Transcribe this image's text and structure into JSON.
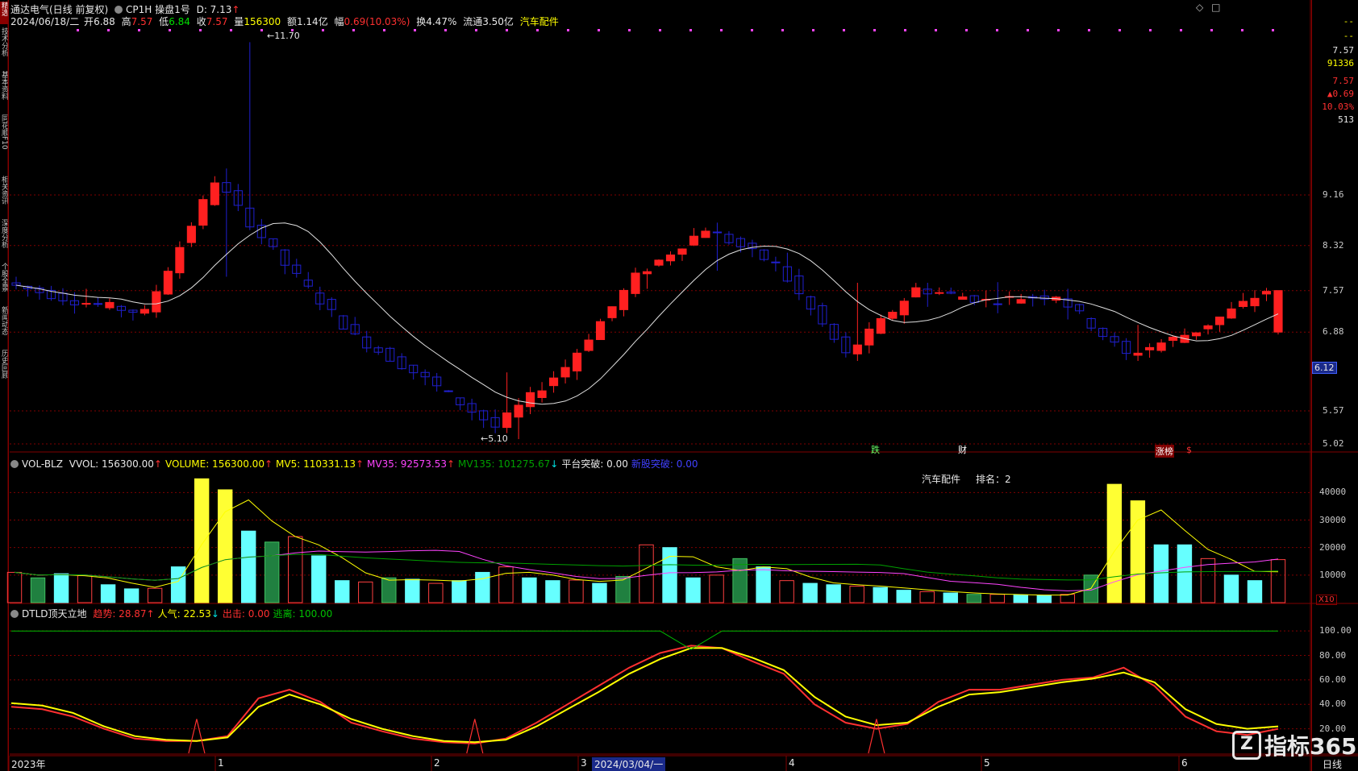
{
  "window": {
    "stock_name": "通达电气(日线 前复权)",
    "formula_name": "CP1H 操盘1号",
    "formula_value": "D: 7.13",
    "formula_arrow": "↑",
    "top_right_icons": [
      "◇",
      "□"
    ]
  },
  "quote": {
    "date": "2024/06/18/二",
    "open_label": "开",
    "open": "6.88",
    "high_label": "高",
    "high": "7.57",
    "low_label": "低",
    "low": "6.84",
    "close_label": "收",
    "close": "7.57",
    "volume_label": "量",
    "volume": "156300",
    "amount_label": "额",
    "amount": "1.14亿",
    "change_label": "幅",
    "change": "0.69(10.03%)",
    "turnover_label": "换",
    "turnover": "4.47%",
    "float_label": "流通",
    "float": "3.50亿",
    "sector": "汽车配件"
  },
  "left_tabs": [
    "精选",
    "技术分析",
    "基本资料",
    "同花顺F10",
    "相关资讯",
    "深度分析",
    "个股全景",
    "新闻动态",
    "历史回顾"
  ],
  "right_panel": {
    "dash1": "--",
    "dash2": "--",
    "price": "7.57",
    "volume": "91336",
    "price2": "7.57",
    "change": "▲0.69",
    "change_pct": "10.03%",
    "count": "513"
  },
  "price_axis": {
    "ticks": [
      "9.16",
      "8.32",
      "7.57",
      "6.88",
      "5.57",
      "5.02"
    ],
    "current_label": "6.12"
  },
  "price_annotations": {
    "high_label": "11.70",
    "low_label": "5.10",
    "markers": [
      {
        "text": "跌",
        "color": "#66ff66"
      },
      {
        "text": "财",
        "color": "#ffffff"
      },
      {
        "text": "涨",
        "color": "#ffffff"
      },
      {
        "text": "榜",
        "color": "#ffffff"
      },
      {
        "text": "$",
        "color": "#ff3333"
      }
    ]
  },
  "volume_panel": {
    "header": {
      "name": "VOL-BLZ",
      "items": [
        {
          "label": "VVOL: 156300.00",
          "arrow": "↑",
          "color": "#e8e8e8"
        },
        {
          "label": "VOLUME: 156300.00",
          "arrow": "↑",
          "color": "#ffff00"
        },
        {
          "label": "MV5: 110331.13",
          "arrow": "↑",
          "color": "#ffff00"
        },
        {
          "label": "MV35: 92573.53",
          "arrow": "↑",
          "color": "#ff44ff"
        },
        {
          "label": "MV135: 101275.67",
          "arrow": "↓",
          "color": "#00a000"
        },
        {
          "label": "平台突破: 0.00",
          "arrow": "",
          "color": "#e8e8e8"
        },
        {
          "label": "新股突破: 0.00",
          "arrow": "",
          "color": "#4040ff"
        }
      ]
    },
    "sector_rank_label": "汽车配件",
    "rank_text": "排名：2",
    "ticks": [
      "40000",
      "30000",
      "20000",
      "10000"
    ],
    "unit": "X10"
  },
  "indicator_panel": {
    "header": {
      "name": "DTLD顶天立地",
      "items": [
        {
          "label": "趋势: 28.87",
          "arrow": "↑",
          "color": "#ff3030"
        },
        {
          "label": "人气: 22.53",
          "arrow": "↓",
          "color": "#ffff00"
        },
        {
          "label": "出击: 0.00",
          "arrow": "",
          "color": "#ff3030"
        },
        {
          "label": "逃离: 100.00",
          "arrow": "",
          "color": "#00c000"
        }
      ]
    },
    "ticks": [
      "100.00",
      "80.00",
      "60.00",
      "40.00",
      "20.00"
    ]
  },
  "time_axis": {
    "labels": [
      "2023年",
      "1",
      "2",
      "3",
      "2024/03/04/一",
      "4",
      "5",
      "6"
    ],
    "period": "日线"
  },
  "watermark": "指标365",
  "colors": {
    "up": "#ff2020",
    "down": "#2020d0",
    "grid": "#800000",
    "ma": "#e0e0e0"
  },
  "chart_data": [
    {
      "type": "candlestick",
      "title": "通达电气(日线 前复权)",
      "x": [
        "2023-12",
        "2024-01",
        "2024-02",
        "2024-03",
        "2024-04",
        "2024-05",
        "2024-06"
      ],
      "ylim": [
        5.02,
        9.16
      ],
      "ohlc_sample": [
        {
          "o": 7.9,
          "h": 8.1,
          "l": 7.6,
          "c": 7.7
        },
        {
          "o": 7.7,
          "h": 7.8,
          "l": 7.3,
          "c": 7.4
        },
        {
          "o": 7.4,
          "h": 7.6,
          "l": 7.1,
          "c": 7.2
        },
        {
          "o": 7.3,
          "h": 11.7,
          "l": 7.2,
          "c": 9.4
        },
        {
          "o": 9.4,
          "h": 9.6,
          "l": 7.8,
          "c": 8.0
        },
        {
          "o": 8.0,
          "h": 8.1,
          "l": 6.6,
          "c": 6.8
        },
        {
          "o": 6.8,
          "h": 6.9,
          "l": 5.9,
          "c": 6.1
        },
        {
          "o": 6.1,
          "h": 6.2,
          "l": 5.1,
          "c": 5.3
        },
        {
          "o": 5.3,
          "h": 6.4,
          "l": 5.2,
          "c": 6.3
        },
        {
          "o": 6.3,
          "h": 7.9,
          "l": 6.2,
          "c": 7.8
        },
        {
          "o": 7.8,
          "h": 8.9,
          "l": 7.6,
          "c": 8.6
        },
        {
          "o": 8.6,
          "h": 8.7,
          "l": 7.9,
          "c": 8.0
        },
        {
          "o": 8.0,
          "h": 8.2,
          "l": 6.3,
          "c": 6.5
        },
        {
          "o": 6.5,
          "h": 7.7,
          "l": 6.4,
          "c": 7.6
        },
        {
          "o": 7.6,
          "h": 7.7,
          "l": 7.3,
          "c": 7.4
        },
        {
          "o": 7.2,
          "h": 9.2,
          "l": 7.1,
          "c": 7.5
        },
        {
          "o": 7.5,
          "h": 7.6,
          "l": 6.3,
          "c": 6.5
        },
        {
          "o": 6.5,
          "h": 7.0,
          "l": 6.4,
          "c": 6.9
        },
        {
          "o": 6.88,
          "h": 7.57,
          "l": 6.84,
          "c": 7.57
        }
      ],
      "annotations": [
        {
          "label": "11.70",
          "kind": "high"
        },
        {
          "label": "5.10",
          "kind": "low"
        }
      ]
    },
    {
      "type": "bar",
      "title": "VOL-BLZ",
      "ylim": [
        0,
        45000
      ],
      "values": [
        11000,
        9000,
        10500,
        9800,
        6500,
        5000,
        5200,
        13000,
        45000,
        41000,
        26000,
        22000,
        24000,
        17000,
        8000,
        7500,
        9000,
        8500,
        7000,
        8000,
        11000,
        13000,
        9000,
        8000,
        8200,
        7000,
        9500,
        21000,
        20000,
        9000,
        10000,
        16000,
        13000,
        8000,
        7000,
        6500,
        6000,
        5500,
        4500,
        4000,
        3500,
        3000,
        3000,
        2800,
        2500,
        3000,
        10000,
        43000,
        37000,
        21000,
        21000,
        16000,
        10000,
        8000,
        15630
      ],
      "series": [
        {
          "name": "MV5",
          "color": "#ffff00"
        },
        {
          "name": "MV35",
          "color": "#ff44ff"
        },
        {
          "name": "MV135",
          "color": "#00a000"
        }
      ]
    },
    {
      "type": "line",
      "title": "DTLD顶天立地",
      "ylim": [
        0,
        110
      ],
      "series": [
        {
          "name": "趋势",
          "color": "#ff3030",
          "values": [
            38,
            36,
            30,
            20,
            12,
            10,
            10,
            14,
            45,
            52,
            42,
            25,
            18,
            12,
            9,
            8,
            12,
            25,
            40,
            55,
            70,
            82,
            88,
            86,
            75,
            65,
            40,
            25,
            20,
            24,
            42,
            52,
            52,
            56,
            60,
            62,
            70,
            55,
            30,
            18,
            15,
            20
          ]
        },
        {
          "name": "人气",
          "color": "#ffff00",
          "values": [
            41,
            39,
            33,
            22,
            14,
            11,
            10,
            13,
            38,
            48,
            40,
            28,
            20,
            14,
            10,
            9,
            11,
            22,
            36,
            50,
            65,
            77,
            86,
            86,
            78,
            68,
            46,
            30,
            23,
            25,
            38,
            48,
            50,
            54,
            58,
            61,
            66,
            58,
            36,
            24,
            20,
            22
          ]
        },
        {
          "name": "出击",
          "color": "#ff3030",
          "values": [
            0,
            0,
            0,
            0,
            0,
            0,
            28,
            0,
            0,
            0,
            0,
            0,
            0,
            0,
            0,
            28,
            0,
            0,
            0,
            0,
            0,
            0,
            0,
            0,
            0,
            0,
            0,
            0,
            28,
            0,
            0,
            0,
            0,
            0,
            0,
            0,
            0,
            0,
            0,
            0,
            0,
            0
          ]
        },
        {
          "name": "逃离",
          "color": "#00c000",
          "values": [
            100,
            100,
            100,
            100,
            100,
            100,
            100,
            100,
            100,
            100,
            100,
            100,
            100,
            100,
            100,
            100,
            100,
            100,
            100,
            100,
            100,
            100,
            85,
            100,
            100,
            100,
            100,
            100,
            100,
            100,
            100,
            100,
            100,
            100,
            100,
            100,
            100,
            100,
            100,
            100,
            100,
            100
          ]
        }
      ]
    }
  ]
}
